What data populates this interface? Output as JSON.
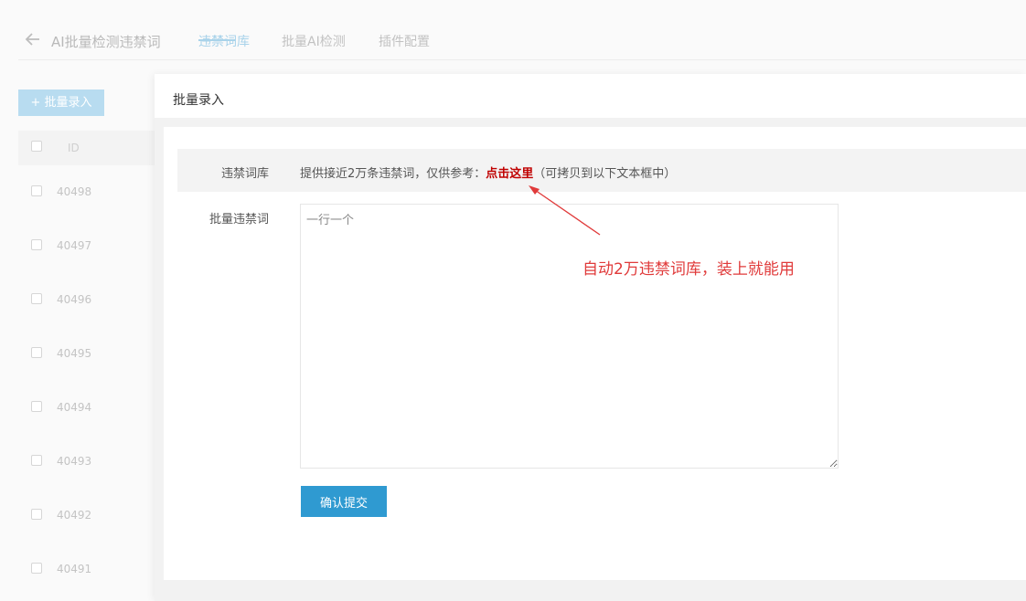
{
  "header": {
    "back_icon": "arrow-left-icon",
    "title": "AI批量检测违禁词",
    "tabs": [
      {
        "label": "违禁词库",
        "active": true
      },
      {
        "label": "批量AI检测",
        "active": false
      },
      {
        "label": "插件配置",
        "active": false
      }
    ]
  },
  "toolbar": {
    "add_label": "+ 批量录入"
  },
  "table": {
    "id_header": "ID",
    "row_ids": [
      "40498",
      "40497",
      "40496",
      "40495",
      "40494",
      "40493",
      "40492",
      "40491"
    ]
  },
  "modal": {
    "title": "批量录入",
    "library_label": "违禁词库",
    "library_text_before": "提供接近2万条违禁词，仅供参考：",
    "library_link": "点击这里",
    "library_text_after": "（可拷贝到以下文本框中）",
    "batch_label": "批量违禁词",
    "textarea_placeholder": "一行一个",
    "submit_label": "确认提交"
  },
  "annotation": {
    "text": "自动2万违禁词库，装上就能用",
    "color": "#e03a3a"
  },
  "colors": {
    "primary": "#2f9ad1",
    "link": "#c00000"
  }
}
